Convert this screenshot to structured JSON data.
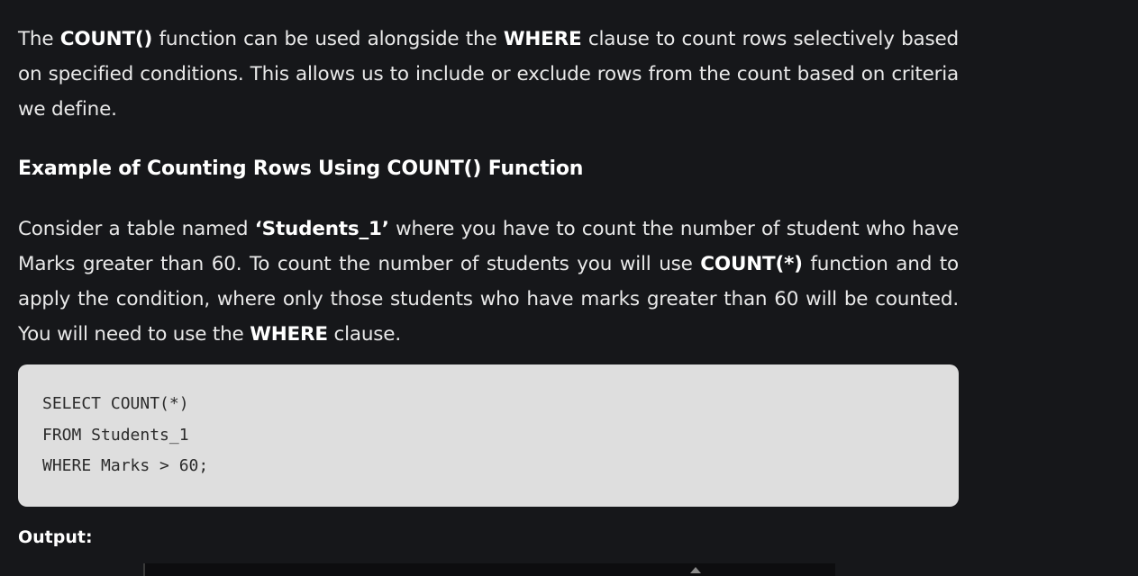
{
  "intro": {
    "t1": "The ",
    "b1": "COUNT()",
    "t2": " function can be used alongside the ",
    "b2": "WHERE",
    "t3": " clause to count rows selectively based on specified conditions. This allows us to include or exclude rows from the count based on criteria we define."
  },
  "heading": "Example of Counting Rows Using COUNT() Function",
  "example": {
    "t1": "Consider a table named ",
    "b1": "‘Students_1’",
    "t2": " where you have to count the number of student who have Marks greater than 60. To count the number of students you will use ",
    "b2": "COUNT(*)",
    "t3": " function and to apply the condition, where only those students who have marks greater than 60 will be counted. You will need to use the ",
    "b3": "WHERE",
    "t4": " clause."
  },
  "code": {
    "lines": [
      "SELECT COUNT(*)",
      "FROM Students_1",
      "WHERE Marks > 60;"
    ]
  },
  "output_label": "Output:",
  "icons": {
    "output_caret": "caret-up-icon"
  }
}
